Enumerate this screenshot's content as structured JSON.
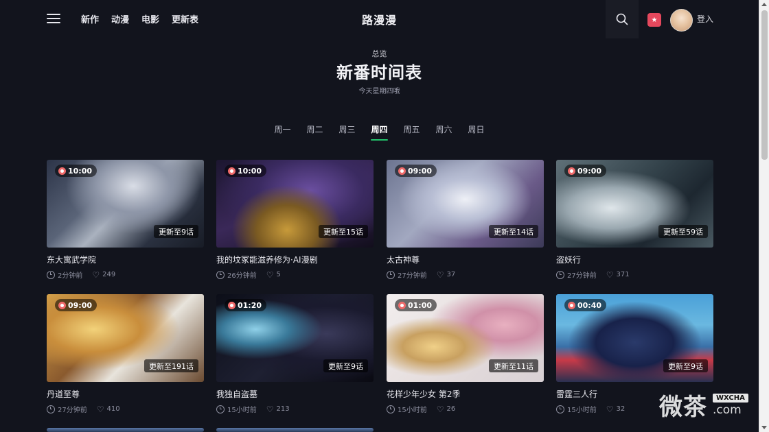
{
  "header": {
    "nav": [
      "新作",
      "动漫",
      "电影",
      "更新表"
    ],
    "brand": "路漫漫",
    "login": "登入",
    "menu_icon": "menu-icon",
    "search_icon": "search-icon",
    "fav_icon": "star-icon"
  },
  "hero": {
    "overview": "总览",
    "title": "新番时间表",
    "today": "今天星期四哦"
  },
  "tabs": {
    "days": [
      "周一",
      "周二",
      "周三",
      "周四",
      "周五",
      "周六",
      "周日"
    ],
    "active": "周四"
  },
  "cards": [
    {
      "time": "10:00",
      "episode": "更新至9话",
      "title": "东大寓武学院",
      "ago": "2分钟前",
      "likes": "249"
    },
    {
      "time": "10:00",
      "episode": "更新至15话",
      "title": "我的坟冢能滋养修为·AI漫剧",
      "ago": "26分钟前",
      "likes": "5"
    },
    {
      "time": "09:00",
      "episode": "更新至14话",
      "title": "太古神尊",
      "ago": "27分钟前",
      "likes": "37"
    },
    {
      "time": "09:00",
      "episode": "更新至59话",
      "title": "盗妖行",
      "ago": "27分钟前",
      "likes": "371"
    },
    {
      "time": "09:00",
      "episode": "更新至191话",
      "title": "丹道至尊",
      "ago": "27分钟前",
      "likes": "410"
    },
    {
      "time": "01:20",
      "episode": "更新至9话",
      "title": "我独自盗墓",
      "ago": "15小时前",
      "likes": "213"
    },
    {
      "time": "01:00",
      "episode": "更新至11话",
      "title": "花样少年少女 第2季",
      "ago": "15小时前",
      "likes": "26"
    },
    {
      "time": "00:40",
      "episode": "更新至9话",
      "title": "雷霆三人行",
      "ago": "15小时前",
      "likes": "32"
    }
  ],
  "watermark": {
    "cn": "微茶",
    "badge": "WXCHA",
    "domain": ".com"
  },
  "colors": {
    "background": "#12141d",
    "active_tab_underline": "#22c46b",
    "fav_badge": "#e5485d"
  }
}
